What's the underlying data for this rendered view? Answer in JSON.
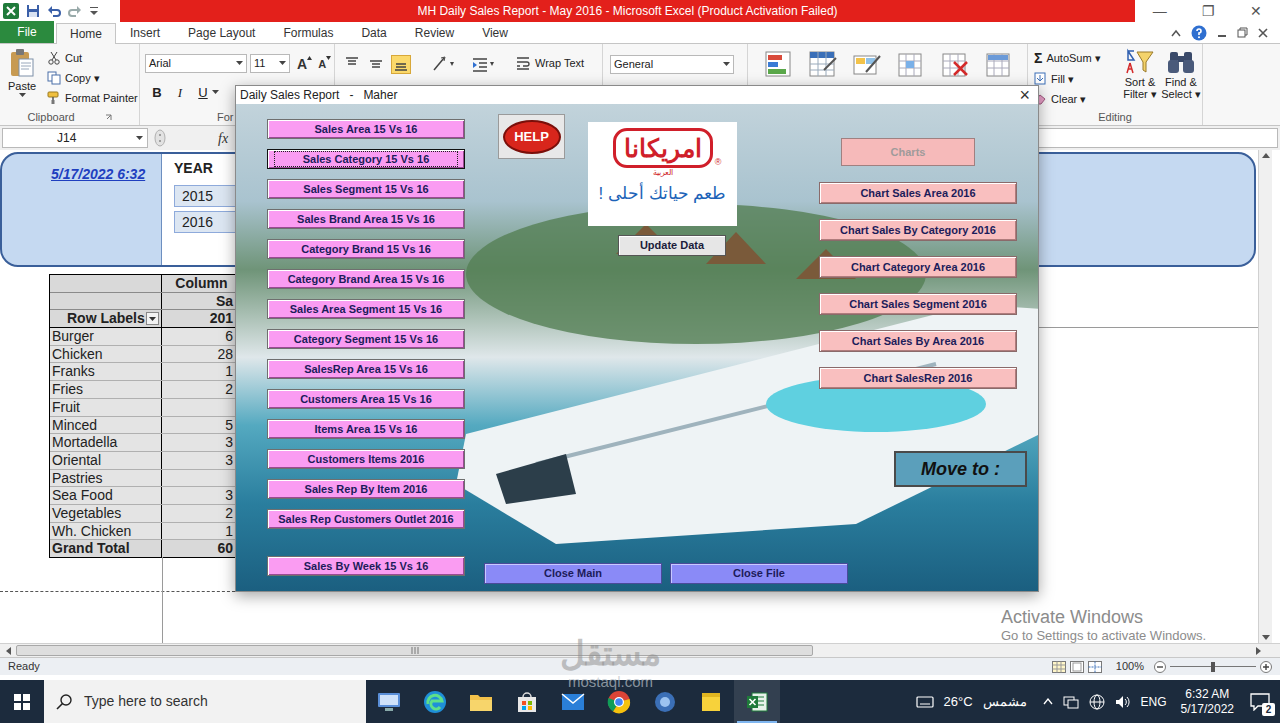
{
  "window": {
    "title": "MH Daily Sales Report - May 2016 - Microsoft Excel (Product Activation Failed)",
    "minimize": "—",
    "restore": "❐",
    "close": "✕"
  },
  "ribbon_tabs": [
    {
      "label": "File",
      "kind": "file",
      "selected": false
    },
    {
      "label": "Home",
      "kind": "tab",
      "selected": true
    },
    {
      "label": "Insert",
      "kind": "tab",
      "selected": false
    },
    {
      "label": "Page Layout",
      "kind": "tab",
      "selected": false
    },
    {
      "label": "Formulas",
      "kind": "tab",
      "selected": false
    },
    {
      "label": "Data",
      "kind": "tab",
      "selected": false
    },
    {
      "label": "Review",
      "kind": "tab",
      "selected": false
    },
    {
      "label": "View",
      "kind": "tab",
      "selected": false
    }
  ],
  "ribbon": {
    "clipboard": {
      "paste": "Paste",
      "items": [
        "Cut",
        "Copy ▾",
        "Format Painter"
      ],
      "label": "Clipboard"
    },
    "font": {
      "family": "Arial",
      "size": "11",
      "grow": "A",
      "shrink": "A",
      "styles": [
        {
          "label": "B",
          "kind": "bold"
        },
        {
          "label": "I",
          "kind": "italic"
        },
        {
          "label": "U",
          "kind": "underline"
        }
      ],
      "label": "For"
    },
    "alignment": {
      "wrap": "Wrap Text"
    },
    "number": {
      "format": "General"
    },
    "editing": {
      "autosum_icon": "Σ",
      "autosum": "AutoSum ▾",
      "fill": "Fill ▾",
      "clear": "Clear ▾",
      "sort": [
        "Sort &",
        "Filter ▾"
      ],
      "find": [
        "Find &",
        "Select ▾"
      ],
      "label": "Editing"
    }
  },
  "formula_bar": {
    "name_box": "J14",
    "fx": "fx"
  },
  "slicer_panel": {
    "timestamp": "5/17/2022 6:32",
    "title": "YEAR",
    "items": [
      {
        "label": "2015",
        "selected": true
      },
      {
        "label": "2016",
        "selected": true
      }
    ]
  },
  "pivot": {
    "header": "Column",
    "subheader": "Sa",
    "row_labels": "Row Labels",
    "column_value": "201",
    "rows": [
      {
        "label": "Burger",
        "value": "6"
      },
      {
        "label": "Chicken",
        "value": "28"
      },
      {
        "label": "Franks",
        "value": "1"
      },
      {
        "label": "Fries",
        "value": "2"
      },
      {
        "label": "Fruit",
        "value": ""
      },
      {
        "label": "Minced",
        "value": "5"
      },
      {
        "label": "Mortadella",
        "value": "3"
      },
      {
        "label": "Oriental",
        "value": "3"
      },
      {
        "label": "Pastries",
        "value": ""
      },
      {
        "label": "Sea Food",
        "value": "3"
      },
      {
        "label": "Vegetables",
        "value": "2"
      },
      {
        "label": "Wh. Chicken",
        "value": "1"
      }
    ],
    "total": {
      "label": "Grand Total",
      "value": "60"
    }
  },
  "dialog": {
    "title": "Daily Sales Report   -   Maher",
    "close": "×",
    "help": "HELP",
    "logo": {
      "brand": "امريكانا",
      "sub": "العربية",
      "mark": "®",
      "tagline": "طعم حياتك أحلى !"
    },
    "update": "Update Data",
    "charts": {
      "label": "Charts",
      "disabled": true
    },
    "left_buttons": [
      {
        "label": "Sales Area 15 Vs 16",
        "focused": false
      },
      {
        "label": "Sales Category 15 Vs 16",
        "focused": true
      },
      {
        "label": "Sales Segment 15 Vs 16",
        "focused": false
      },
      {
        "label": "Sales Brand Area 15 Vs 16",
        "focused": false
      },
      {
        "label": "Category Brand 15 Vs 16",
        "focused": false
      },
      {
        "label": "Category Brand Area 15 Vs 16",
        "focused": false
      },
      {
        "label": "Sales Area Segment 15 Vs 16",
        "focused": false
      },
      {
        "label": "Category Segment 15 Vs 16",
        "focused": false
      },
      {
        "label": "SalesRep Area 15 Vs 16",
        "focused": false
      },
      {
        "label": "Customers Area 15 Vs 16",
        "focused": false
      },
      {
        "label": "Items Area 15 Vs 16",
        "focused": false
      },
      {
        "label": "Customers Items 2016",
        "focused": false
      },
      {
        "label": "Sales Rep By Item 2016",
        "focused": false
      },
      {
        "label": "Sales Rep Customers Outlet 2016",
        "focused": false
      }
    ],
    "week_button": "Sales By Week 15 Vs 16",
    "chart_buttons": [
      "Chart Sales Area 2016",
      "Chart Sales By Category 2016",
      "Chart Category Area 2016",
      "Chart Sales Segment 2016",
      "Chart Sales By Area 2016",
      "Chart SalesRep 2016"
    ],
    "move_to": "Move to :",
    "bottom_buttons": [
      "Close Main",
      "Close File"
    ]
  },
  "watermark": {
    "line1": "Activate Windows",
    "line2": "Go to Settings to activate Windows."
  },
  "status_bar": {
    "text": "Ready",
    "zoom": "100%",
    "zoom_level": 0.5
  },
  "taskbar": {
    "search": "Type here to search",
    "temperature": "26°C",
    "weather": "مشمس",
    "language": "ENG",
    "time": "6:32 AM",
    "date": "5/17/2022",
    "notifications": "2",
    "excel_active": true
  },
  "site_watermark": {
    "arabic": "مستقل",
    "latin": "mostaql.com"
  }
}
